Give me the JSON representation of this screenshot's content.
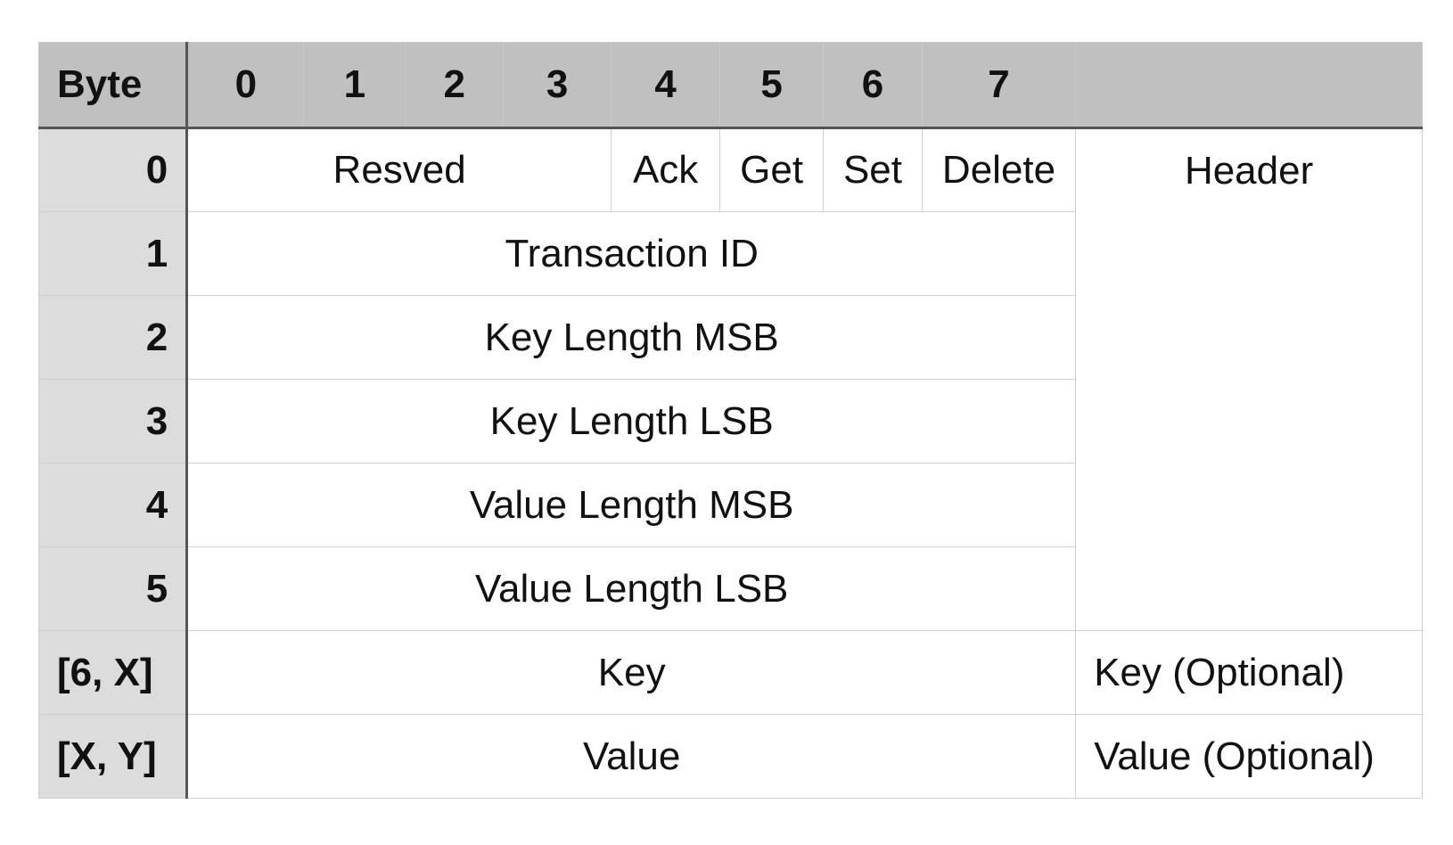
{
  "header": {
    "corner": "Byte",
    "bits": [
      "0",
      "1",
      "2",
      "3",
      "4",
      "5",
      "6",
      "7"
    ],
    "group": ""
  },
  "rows": {
    "byte0": {
      "label": "0",
      "resved": "Resved",
      "ack": "Ack",
      "get": "Get",
      "set": "Set",
      "delete": "Delete",
      "group": "Header"
    },
    "byte1": {
      "label": "1",
      "field": "Transaction ID"
    },
    "byte2": {
      "label": "2",
      "field": "Key Length MSB"
    },
    "byte3": {
      "label": "3",
      "field": "Key Length LSB"
    },
    "byte4": {
      "label": "4",
      "field": "Value Length MSB"
    },
    "byte5": {
      "label": "5",
      "field": "Value Length LSB"
    },
    "key": {
      "label": "[6, X]",
      "field": "Key",
      "group": "Key (Optional)"
    },
    "value": {
      "label": "[X, Y]",
      "field": "Value",
      "group": "Value (Optional)"
    }
  }
}
